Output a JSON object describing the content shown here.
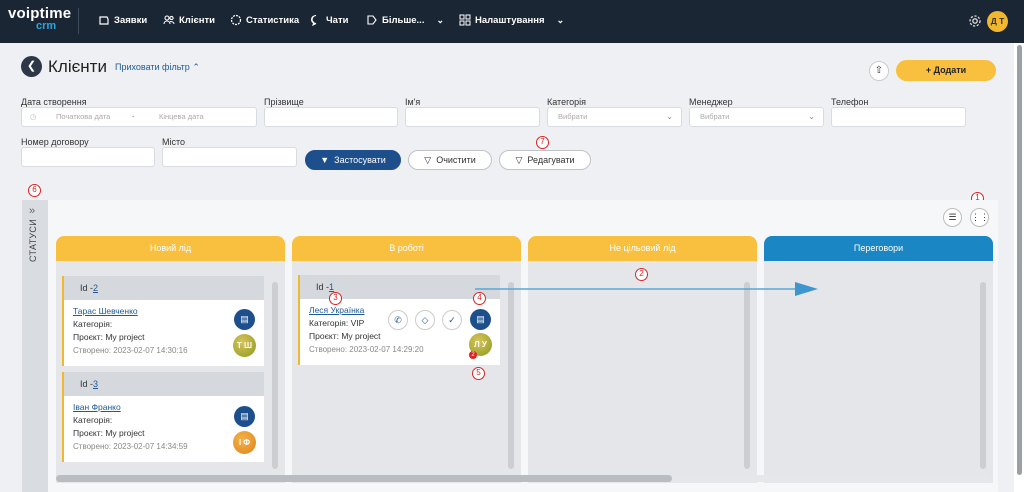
{
  "logo": {
    "line1": "voiptime",
    "line2": "crm"
  },
  "nav": {
    "orders": "Заявки",
    "clients": "Клієнти",
    "statistics": "Статистика",
    "chats": "Чати",
    "more": "Більше...",
    "settings": "Налаштування"
  },
  "user": {
    "initials": "Д Т"
  },
  "page": {
    "title": "Клієнти",
    "hide_filter": "Приховати фільтр",
    "add_button": "+ Додати"
  },
  "filters": {
    "created_label": "Дата створення",
    "date_start_placeholder": "Початкова дата",
    "date_dash": "-",
    "date_end_placeholder": "Кінцева дата",
    "surname_label": "Прізвище",
    "name_label": "Ім'я",
    "category_label": "Категорія",
    "category_placeholder": "Вибрати",
    "manager_label": "Менеджер",
    "manager_placeholder": "Вибрати",
    "phone_label": "Телефон",
    "contract_label": "Номер договору",
    "city_label": "Місто",
    "apply_button": "Застосувати",
    "clear_button": "Очистити",
    "edit_button": "Редагувати"
  },
  "annotations": {
    "a1": "1",
    "a2": "2",
    "a3": "3",
    "a4": "4",
    "a5": "5",
    "a6": "6",
    "a7": "7"
  },
  "sidebar": {
    "statuses_label": "СТАТУСИ"
  },
  "columns": [
    {
      "title": "Новий лід",
      "color": "#f8c03e"
    },
    {
      "title": "В роботі",
      "color": "#f8c03e"
    },
    {
      "title": "Не цільовий лід",
      "color": "#f8c03e"
    },
    {
      "title": "Переговори",
      "color": "#1a86c4"
    }
  ],
  "cards": [
    {
      "id_prefix": "Id -",
      "id": "2",
      "name": "Тарас Шевченко",
      "category": "Категорія:",
      "project": "Проєкт: My project",
      "created": "Створено: 2023-02-07 14:30:16",
      "initials": "Т Ш"
    },
    {
      "id_prefix": "Id -",
      "id": "3",
      "name": "Іван Франко",
      "category": "Категорія:",
      "project": "Проєкт: My project",
      "created": "Створено: 2023-02-07 14:34:59",
      "initials": "І Ф"
    },
    {
      "id_prefix": "Id -",
      "id": "1",
      "name": "Леся Українка",
      "category": "Категорія: VIP",
      "project": "Проєкт: My project",
      "created": "Створено: 2023-02-07 14:29:20",
      "initials": "Л У",
      "badge": "2"
    }
  ]
}
